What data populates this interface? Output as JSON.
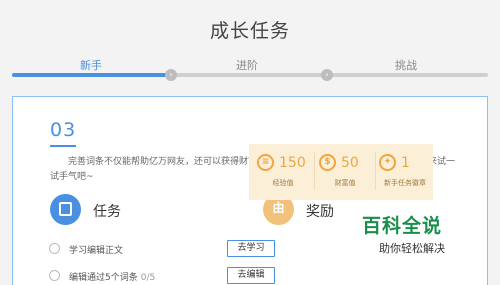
{
  "page": {
    "title": "成长任务"
  },
  "tabs": [
    {
      "label": "新手",
      "active": true
    },
    {
      "label": "进阶",
      "active": false
    },
    {
      "label": "挑战",
      "active": false
    }
  ],
  "progress": {
    "completed_fraction": 0.33,
    "node_glyph": "›"
  },
  "card": {
    "step_number": "03",
    "intro": "完善词条不仅能帮助亿万网友，还可以获得财富值用于礼品兑换和抽奖哦！赶快到百科商城来试一试手气吧~"
  },
  "tasks": {
    "title": "任务",
    "icon": "document-icon",
    "items": [
      {
        "text": "学习编辑正文",
        "count": "",
        "button": "去学习"
      },
      {
        "text": "编辑通过5个词条",
        "count": "0/5",
        "button": "去编辑"
      }
    ]
  },
  "rewards": {
    "title": "奖励",
    "icon_glyph": "由",
    "items": [
      {
        "value": "150",
        "label": "经验值",
        "coin": "≡"
      },
      {
        "value": "50",
        "label": "财富值",
        "coin": "$"
      },
      {
        "value": "1",
        "label": "新手任务徽章",
        "coin": "✦"
      }
    ]
  },
  "watermark": {
    "main": "百科全说",
    "sub": "助你轻松解决"
  },
  "colors": {
    "accent": "#4a90e2",
    "reward": "#f0a640",
    "brand_green": "#1b8e4c"
  }
}
